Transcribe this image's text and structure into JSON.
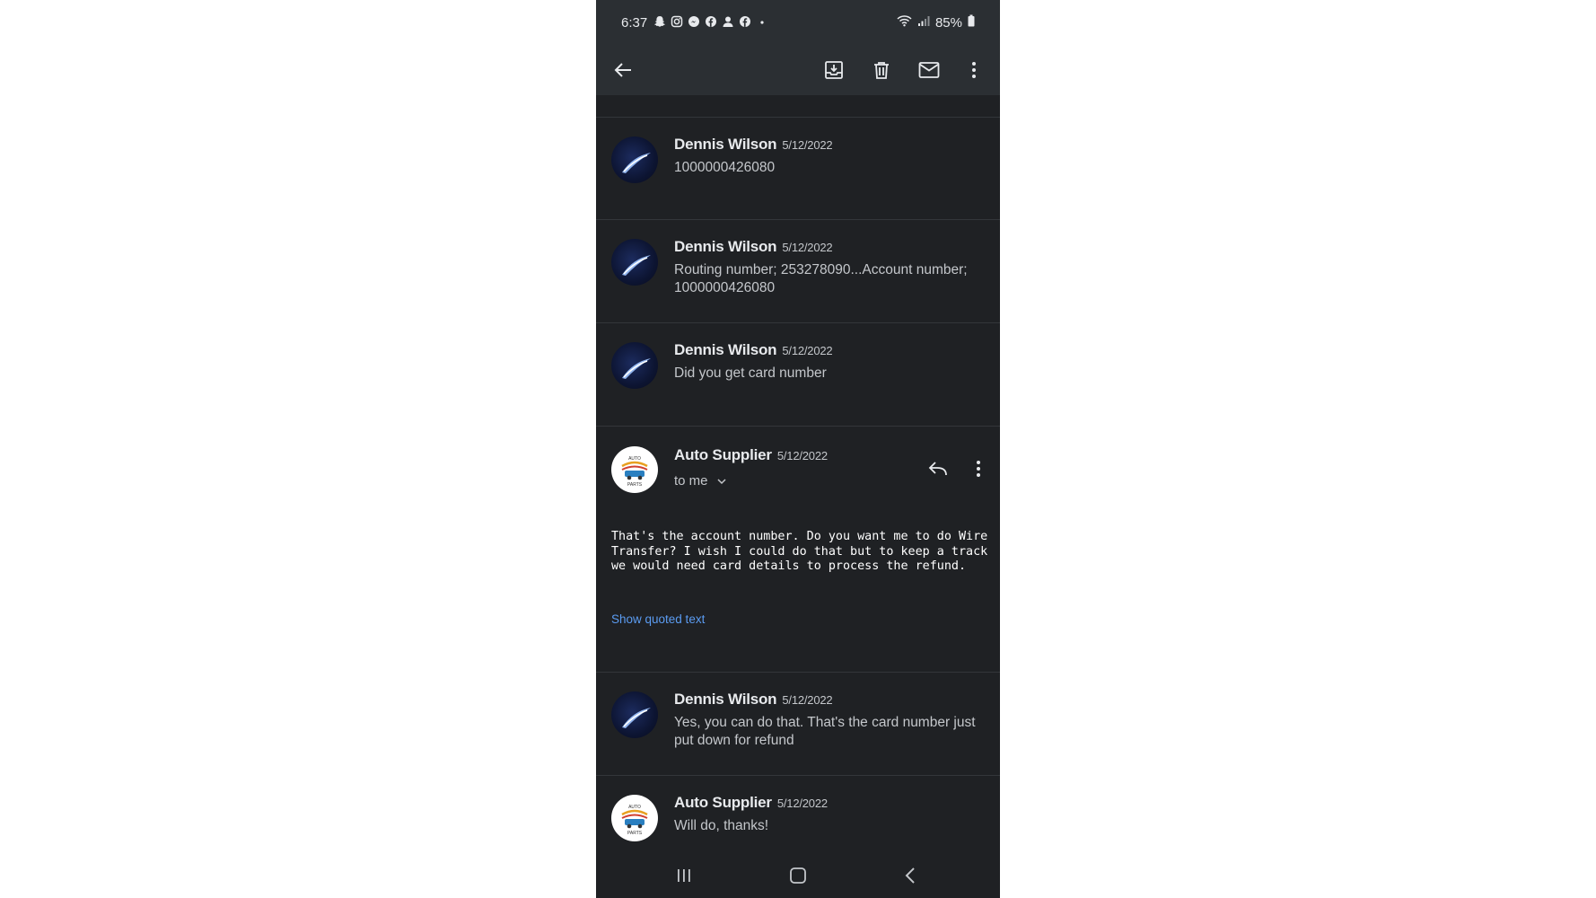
{
  "status_bar": {
    "time": "6:37",
    "battery": "85%"
  },
  "messages": [
    {
      "sender": "Dennis Wilson",
      "date": "5/12/2022",
      "snippet": "1000000426080"
    },
    {
      "sender": "Dennis Wilson",
      "date": "5/12/2022",
      "snippet": "Routing number; 253278090...Account number; 1000000426080"
    },
    {
      "sender": "Dennis Wilson",
      "date": "5/12/2022",
      "snippet": "Did you get card number"
    },
    {
      "sender": "Auto Supplier",
      "date": "5/12/2022",
      "recipient": "to me",
      "body": "That's the account number. Do you want me to do Wire Transfer? I wish I could do that but to keep a track we would need card details to process the refund.",
      "show_quoted": "Show quoted text"
    },
    {
      "sender": "Dennis Wilson",
      "date": "5/12/2022",
      "snippet": "Yes, you can do that. That's the card number just put down for refund"
    },
    {
      "sender": "Auto Supplier",
      "date": "5/12/2022",
      "snippet": "Will do, thanks!"
    }
  ],
  "logo_text": {
    "top": "AUTO",
    "bottom": "PARTS"
  },
  "colors": {
    "background": "#1f2124",
    "toolbar": "#2b2f33",
    "link": "#5b9cf2"
  }
}
